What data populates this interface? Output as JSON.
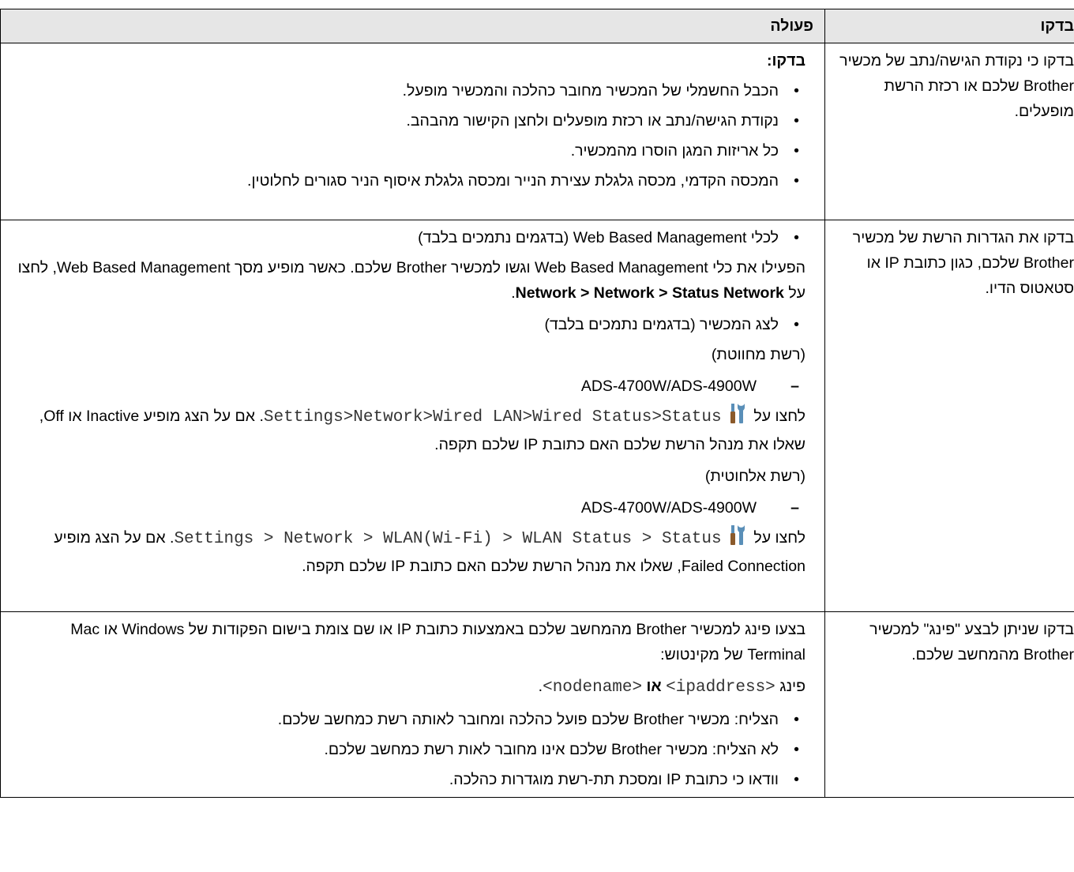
{
  "header": {
    "col_check": "בדקו",
    "col_action": "פעולה"
  },
  "rows": [
    {
      "check": "בדקו כי נקודת הגישה/נתב של מכשיר Brother שלכם או רכזת הרשת מופעלים.",
      "action": {
        "label": "בדקו:",
        "bullets": [
          "הכבל החשמלי של המכשיר מחובר כהלכה והמכשיר מופעל.",
          "נקודת הגישה/נתב או רכזת מופעלים ולחצן הקישור מהבהב.",
          "כל אריזות המגן הוסרו מהמכשיר.",
          "המכסה הקדמי, מכסה גלגלת עצירת הנייר ומכסה גלגלת איסוף הניר סגורים לחלוטין."
        ]
      }
    },
    {
      "check": "בדקו את הגדרות הרשת של מכשיר Brother שלכם, כגון כתובת IP או סטאטוס הדיו.",
      "action": {
        "web_bullet": "לכלי Web Based Management (בדגמים נתמכים בלבד)",
        "web_text": "הפעילו את כלי Web Based Management וגשו למכשיר Brother שלכם. כאשר מופיע מסך Web Based Management, לחצו על",
        "web_path": "Network > Network > Status Network",
        "web_end": ".",
        "panel_bullet": "לצג המכשיר (בדגמים נתמכים בלבד)",
        "wired_label": "(רשת מחווטת)",
        "model_1": "ADS-4700W/ADS-4900W",
        "press_on": "לחצו על",
        "wired_path": "Settings>Network>Wired LAN>Wired Status>Status",
        "wired_text": ". אם על הצג מופיע Inactive או Off, שאלו את מנהל הרשת שלכם האם כתובת IP שלכם תקפה.",
        "wireless_label": "(רשת אלחוטית)",
        "model_2": "ADS-4700W/ADS-4900W",
        "wireless_path": "Settings > Network > WLAN(Wi-Fi) > WLAN Status > Status",
        "wireless_text": ". אם על הצג מופיע Failed Connection, שאלו את מנהל הרשת שלכם האם כתובת IP שלכם תקפה."
      }
    },
    {
      "check": "בדקו שניתן לבצע \"פינג\" למכשיר Brother מהמחשב שלכם.",
      "action": {
        "intro": "בצעו פינג למכשיר Brother מהמחשב שלכם באמצעות כתובת IP או שם צומת בישום הפקודות של Windows או Mac Terminal של מקינטוש:",
        "ping_word": "פינג",
        "ping_arg1": "<ipaddress>",
        "ping_or": "או",
        "ping_arg2": "<nodename>",
        "ping_end": ".",
        "bullets": [
          "הצליח: מכשיר Brother שלכם פועל כהלכה ומחובר לאותה רשת כמחשב שלכם.",
          "לא הצליח: מכשיר Brother שלכם אינו מחובר לאות רשת כמחשב שלכם.",
          "וודאו כי כתובת IP ומסכת תת-רשת מוגדרות כהלכה."
        ]
      }
    }
  ],
  "icons": {
    "settings": "settings-tools-icon"
  }
}
